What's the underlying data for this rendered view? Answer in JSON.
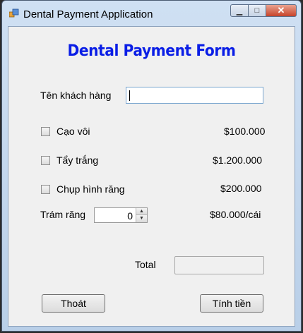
{
  "window": {
    "title": "Dental Payment Application"
  },
  "form": {
    "heading": "Dental Payment Form",
    "customer_label": "Tên khách hàng",
    "customer_value": "",
    "services": [
      {
        "label": "Cạo vôi",
        "price": "$100.000",
        "checked": false
      },
      {
        "label": "Tẩy trắng",
        "price": "$1.200.000",
        "checked": false
      },
      {
        "label": "Chụp hình răng",
        "price": "$200.000",
        "checked": false
      }
    ],
    "filling_label": "Trám răng",
    "filling_quantity": "0",
    "filling_price": "$80.000/cái",
    "total_label": "Total",
    "total_value": "",
    "exit_button": "Thoát",
    "calc_button": "Tính tiền"
  },
  "icons": {
    "app": "app-icon",
    "minimize": "minimize-icon",
    "maximize": "maximize-icon",
    "close": "close-icon"
  },
  "colors": {
    "heading": "#0a1ee6",
    "client_bg": "#f0f0f0",
    "close_button": "#c7432a"
  }
}
